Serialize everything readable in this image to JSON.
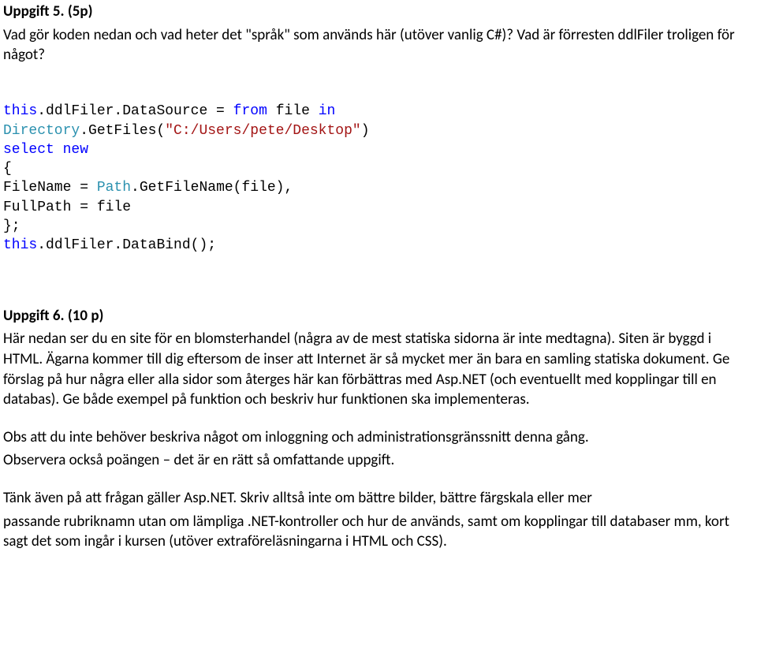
{
  "task5": {
    "heading": "Uppgift 5. (5p)",
    "intro": "Vad gör koden nedan och vad heter det \"språk\" som används här (utöver vanlig C#)? Vad är förresten ddlFiler troligen för något?",
    "code": {
      "l1": {
        "kw1": "this",
        "t1": ".ddlFiler.DataSource = ",
        "kw2": "from",
        "t2": " file ",
        "kw3": "in"
      },
      "l2": {
        "cls": "Directory",
        "t1": ".GetFiles(",
        "str": "\"C:/Users/pete/Desktop\"",
        "t2": ")"
      },
      "l3": {
        "kw1": "select",
        "t1": " ",
        "kw2": "new"
      },
      "l4": {
        "t": "{"
      },
      "l5": {
        "t1": "FileName = ",
        "cls": "Path",
        "t2": ".GetFileName(file),"
      },
      "l6": {
        "t": "FullPath = file"
      },
      "l7": {
        "t": "};"
      },
      "l8": {
        "kw": "this",
        "t": ".ddlFiler.DataBind();"
      }
    }
  },
  "task6": {
    "heading": "Uppgift 6. (10 p)",
    "p1": "Här nedan ser du en site för en blomsterhandel (några av de mest statiska sidorna är inte medtagna). Siten är byggd i HTML. Ägarna kommer till dig eftersom de inser att Internet är så mycket mer än bara en samling statiska dokument. Ge förslag på hur några eller alla sidor som återges här kan förbättras med Asp.NET (och eventuellt med kopplingar till en databas). Ge både exempel på funktion och beskriv hur funktionen ska implementeras.",
    "p2a": "Obs att du inte behöver beskriva något om inloggning och administrationsgränssnitt denna gång.",
    "p2b": "Observera också poängen – det är en rätt så omfattande uppgift.",
    "p3a": "Tänk även på att frågan gäller Asp.NET. Skriv alltså inte om bättre bilder, bättre färgskala eller mer",
    "p3b": "passande rubriknamn utan om lämpliga .NET-kontroller och hur de används, samt om kopplingar till databaser mm, kort sagt det som ingår i kursen (utöver extraföreläsningarna i HTML och CSS)."
  }
}
